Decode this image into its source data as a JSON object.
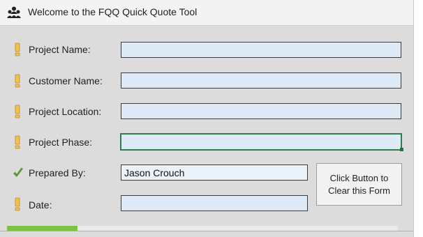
{
  "app": {
    "title": "Welcome to the FQQ Quick Quote Tool",
    "title_icon": "people-group-icon"
  },
  "form": {
    "fields": [
      {
        "label": "Project Name:",
        "value": "",
        "status": "required",
        "status_icon": "exclamation-icon"
      },
      {
        "label": "Customer Name:",
        "value": "",
        "status": "required",
        "status_icon": "exclamation-icon"
      },
      {
        "label": "Project Location:",
        "value": "",
        "status": "required",
        "status_icon": "exclamation-icon"
      },
      {
        "label": "Project Phase:",
        "value": "",
        "status": "required",
        "status_icon": "exclamation-icon",
        "active": true
      },
      {
        "label": "Prepared By:",
        "value": "Jason Crouch",
        "status": "complete",
        "status_icon": "checkmark-icon"
      },
      {
        "label": "Date:",
        "value": "",
        "status": "required",
        "status_icon": "exclamation-icon"
      }
    ],
    "clear_button": "Click Button to Clear this Form"
  },
  "progress": {
    "fraction": 0.18
  },
  "colors": {
    "required_marker": "#f2c14e",
    "complete_marker": "#5a9a3c",
    "field_fill": "#deebf6",
    "active_border": "#2e7d4a",
    "progress_fill": "#7cc142"
  }
}
